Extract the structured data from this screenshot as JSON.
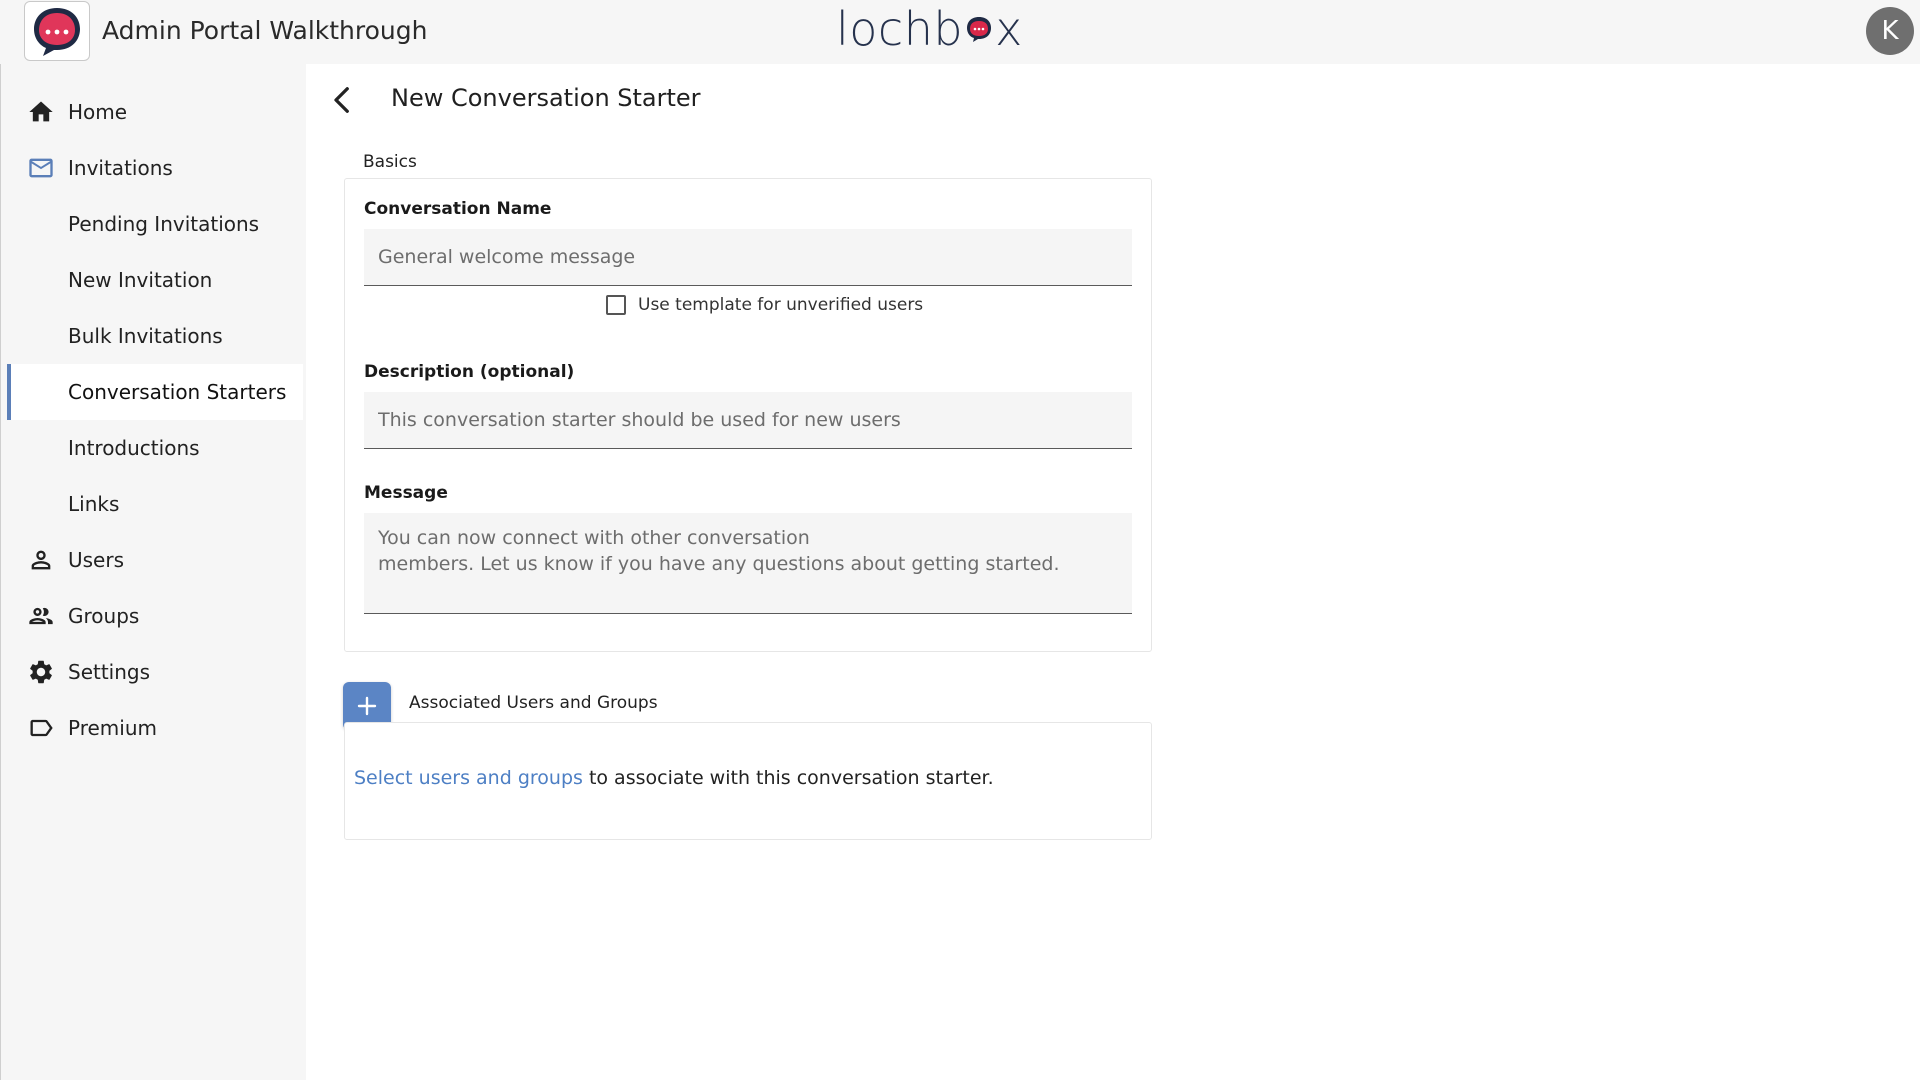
{
  "header": {
    "app_title": "Admin Portal Walkthrough",
    "brand_prefix": "lochb",
    "brand_suffix": "x",
    "avatar_initial": "K"
  },
  "sidebar": {
    "items": [
      {
        "label": "Home",
        "icon": "home-icon"
      },
      {
        "label": "Invitations",
        "icon": "mail-icon"
      },
      {
        "label": "Pending Invitations"
      },
      {
        "label": "New Invitation"
      },
      {
        "label": "Bulk Invitations"
      },
      {
        "label": "Conversation Starters",
        "active": true
      },
      {
        "label": "Introductions"
      },
      {
        "label": "Links"
      },
      {
        "label": "Users",
        "icon": "person-icon"
      },
      {
        "label": "Groups",
        "icon": "people-icon"
      },
      {
        "label": "Settings",
        "icon": "gear-icon"
      },
      {
        "label": "Premium",
        "icon": "tag-icon"
      }
    ]
  },
  "page": {
    "title": "New Conversation Starter",
    "basics_label": "Basics",
    "conversation_name": {
      "label": "Conversation Name",
      "placeholder": "General welcome message"
    },
    "template_checkbox": {
      "label": "Use template for unverified users",
      "checked": false
    },
    "description": {
      "label": "Description (optional)",
      "placeholder": "This conversation starter should be used for new users"
    },
    "message": {
      "label": "Message",
      "placeholder": "You can now connect with other conversation\nmembers. Let us know if you have any questions about getting started."
    },
    "associated": {
      "label": "Associated Users and Groups",
      "link_text": "Select users and groups",
      "rest_text": " to associate with this conversation starter."
    }
  },
  "colors": {
    "accent": "#5b85c5",
    "active_indicator": "#5b7fb8",
    "link": "#4d7fc4",
    "brand_red": "#d9284a",
    "brand_navy": "#26324d"
  }
}
